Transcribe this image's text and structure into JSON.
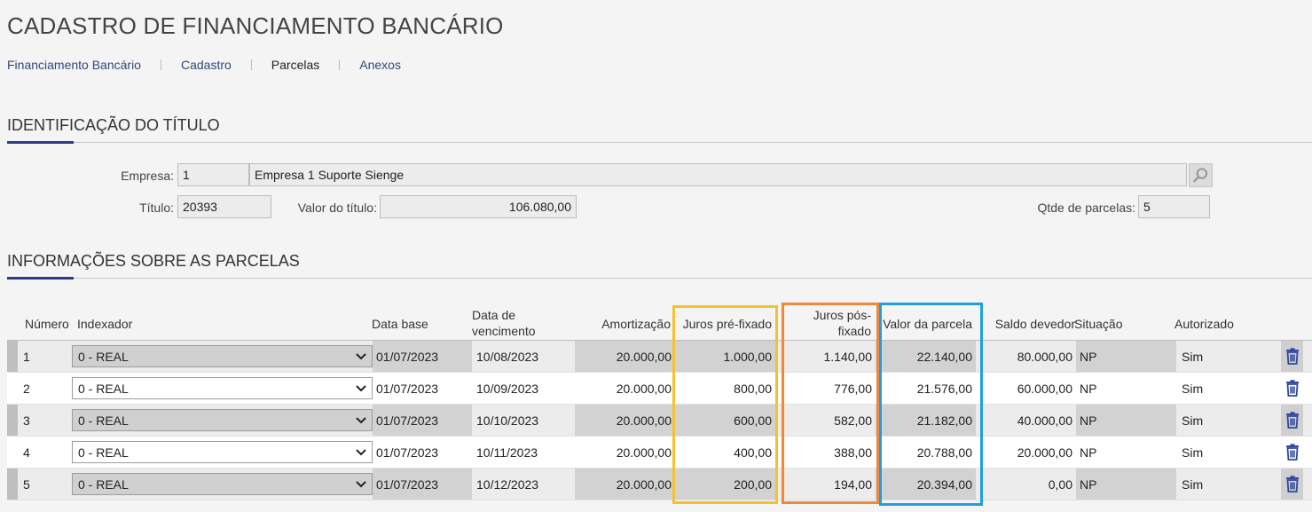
{
  "page": {
    "title": "CADASTRO DE FINANCIAMENTO BANCÁRIO"
  },
  "tabs": [
    {
      "label": "Financiamento Bancário"
    },
    {
      "label": "Cadastro"
    },
    {
      "label": "Parcelas"
    },
    {
      "label": "Anexos"
    }
  ],
  "identification": {
    "title": "IDENTIFICAÇÃO DO TÍTULO",
    "empresa_label": "Empresa:",
    "empresa_code": "1",
    "empresa_name": "Empresa 1 Suporte Sienge",
    "titulo_label": "Título:",
    "titulo_value": "20393",
    "valor_label": "Valor do título:",
    "valor_value": "106.080,00",
    "qtde_label": "Qtde de parcelas:",
    "qtde_value": "5"
  },
  "parcelas": {
    "title": "INFORMAÇÕES SOBRE AS PARCELAS",
    "columns": {
      "numero": "Número",
      "indexador": "Indexador",
      "data_base": "Data base",
      "data_venc": "Data de vencimento",
      "amortizacao": "Amortização",
      "juros_pre": "Juros pré-fixado",
      "juros_pos": "Juros pós-fixado",
      "valor_parcela": "Valor da parcela",
      "saldo": "Saldo devedor",
      "situacao": "Situação",
      "autorizado": "Autorizado"
    },
    "rows": [
      {
        "numero": "1",
        "indexador": "0 - REAL",
        "data_base": "01/07/2023",
        "data_venc": "10/08/2023",
        "amortizacao": "20.000,00",
        "juros_pre": "1.000,00",
        "juros_pos": "1.140,00",
        "valor_parcela": "22.140,00",
        "saldo": "80.000,00",
        "situacao": "NP",
        "autorizado": "Sim"
      },
      {
        "numero": "2",
        "indexador": "0 - REAL",
        "data_base": "01/07/2023",
        "data_venc": "10/09/2023",
        "amortizacao": "20.000,00",
        "juros_pre": "800,00",
        "juros_pos": "776,00",
        "valor_parcela": "21.576,00",
        "saldo": "60.000,00",
        "situacao": "NP",
        "autorizado": "Sim"
      },
      {
        "numero": "3",
        "indexador": "0 - REAL",
        "data_base": "01/07/2023",
        "data_venc": "10/10/2023",
        "amortizacao": "20.000,00",
        "juros_pre": "600,00",
        "juros_pos": "582,00",
        "valor_parcela": "21.182,00",
        "saldo": "40.000,00",
        "situacao": "NP",
        "autorizado": "Sim"
      },
      {
        "numero": "4",
        "indexador": "0 - REAL",
        "data_base": "01/07/2023",
        "data_venc": "10/11/2023",
        "amortizacao": "20.000,00",
        "juros_pre": "400,00",
        "juros_pos": "388,00",
        "valor_parcela": "20.788,00",
        "saldo": "20.000,00",
        "situacao": "NP",
        "autorizado": "Sim"
      },
      {
        "numero": "5",
        "indexador": "0 - REAL",
        "data_base": "01/07/2023",
        "data_venc": "10/12/2023",
        "amortizacao": "20.000,00",
        "juros_pre": "200,00",
        "juros_pos": "194,00",
        "valor_parcela": "20.394,00",
        "saldo": "0,00",
        "situacao": "NP",
        "autorizado": "Sim"
      }
    ]
  },
  "icons": {
    "search": "search-icon",
    "delete": "trash-icon",
    "dropdown": "chevron-down-icon"
  },
  "colors": {
    "accent": "#2d3a8c",
    "highlight_juros_pre": "#f5c12e",
    "highlight_juros_pos": "#f0883a",
    "highlight_valor_parcela": "#1ea0e0",
    "delete_icon": "#2e4a9a"
  }
}
